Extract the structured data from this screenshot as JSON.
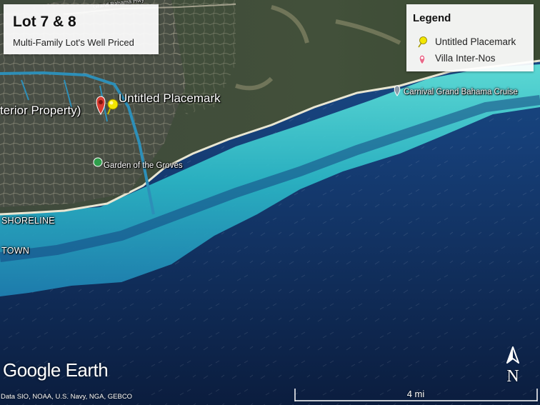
{
  "title_card": {
    "title": "Lot 7 & 8",
    "subtitle": "Multi-Family Lot's Well Priced"
  },
  "legend": {
    "heading": "Legend",
    "items": [
      {
        "label": "Untitled Placemark",
        "icon": "yellow-pushpin-icon",
        "color": "#f2e600"
      },
      {
        "label": "Villa Inter-Nos",
        "icon": "pink-pin-icon",
        "color": "#e86a8a"
      }
    ]
  },
  "map_labels": {
    "untitled_placemark": "Untitled Placemark",
    "exterior_property": "terior Property)",
    "garden": "Garden of the Groves",
    "carnival": "Carnival Grand Bahama Cruise",
    "shoreline": "SHORELINE",
    "town": "TOWN",
    "road": "Grand Bahama Hwy"
  },
  "branding": "Google Earth",
  "attribution": "Data SIO, NOAA, U.S. Navy, NGA, GEBCO",
  "scale_label": "4 mi",
  "north_label": "N",
  "colors": {
    "deep_ocean": "#10254a",
    "shallow_water": "#3fc6c9",
    "land": "#3d4a34",
    "marker_red": "#d83a30"
  }
}
